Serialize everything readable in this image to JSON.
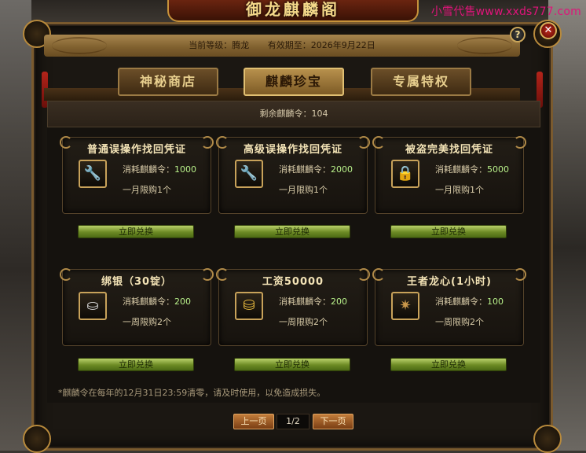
{
  "window": {
    "title": "御龙麒麟阁"
  },
  "watermark": "小雪代售www.xxds777.com",
  "info": {
    "level_label": "当前等级：腾龙",
    "expiry_label": "有效期至：2026年9月22日"
  },
  "controls": {
    "help": "?",
    "close": "✕"
  },
  "tabs": [
    {
      "label": "神秘商店",
      "active": false
    },
    {
      "label": "麒麟珍宝",
      "active": true
    },
    {
      "label": "专属特权",
      "active": false
    }
  ],
  "remaining": "剩余麒麟令：104",
  "items": [
    {
      "title": "普通误操作找回凭证",
      "icon": "wrench-icon",
      "cost_label": "消耗麒麟令：",
      "cost": "1000",
      "limit": "一月限购1个",
      "button": "立即兑换"
    },
    {
      "title": "高级误操作找回凭证",
      "icon": "wrench-icon",
      "cost_label": "消耗麒麟令：",
      "cost": "2000",
      "limit": "一月限购1个",
      "button": "立即兑换"
    },
    {
      "title": "被盗完美找回凭证",
      "icon": "lock-icon",
      "cost_label": "消耗麒麟令：",
      "cost": "5000",
      "limit": "一月限购1个",
      "button": "立即兑换"
    },
    {
      "title": "绑银（30锭）",
      "icon": "silver-ingot-icon",
      "cost_label": "消耗麒麟令：",
      "cost": "200",
      "limit": "一周限购2个",
      "button": "立即兑换"
    },
    {
      "title": "工资50000",
      "icon": "gold-coins-icon",
      "cost_label": "消耗麒麟令：",
      "cost": "200",
      "limit": "一周限购2个",
      "button": "立即兑换"
    },
    {
      "title": "王者龙心(1小时)",
      "icon": "dragon-heart-icon",
      "cost_label": "消耗麒麟令：",
      "cost": "100",
      "limit": "一周限购2个",
      "button": "立即兑换"
    }
  ],
  "note": "*麒麟令在每年的12月31日23:59清零，请及时使用，以免造成损失。",
  "pager": {
    "prev": "上一页",
    "page": "1/2",
    "next": "下一页"
  },
  "colors": {
    "accent_gold": "#e8cf8e",
    "cost_green": "#b8f08a",
    "watermark_pink": "#e0147a"
  }
}
